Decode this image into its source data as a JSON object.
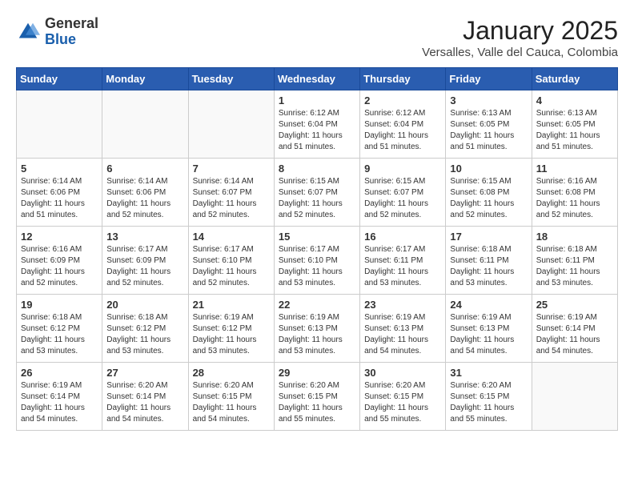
{
  "header": {
    "logo": {
      "general": "General",
      "blue": "Blue"
    },
    "title": "January 2025",
    "location": "Versalles, Valle del Cauca, Colombia"
  },
  "weekdays": [
    "Sunday",
    "Monday",
    "Tuesday",
    "Wednesday",
    "Thursday",
    "Friday",
    "Saturday"
  ],
  "weeks": [
    [
      {
        "day": "",
        "info": ""
      },
      {
        "day": "",
        "info": ""
      },
      {
        "day": "",
        "info": ""
      },
      {
        "day": "1",
        "info": "Sunrise: 6:12 AM\nSunset: 6:04 PM\nDaylight: 11 hours\nand 51 minutes."
      },
      {
        "day": "2",
        "info": "Sunrise: 6:12 AM\nSunset: 6:04 PM\nDaylight: 11 hours\nand 51 minutes."
      },
      {
        "day": "3",
        "info": "Sunrise: 6:13 AM\nSunset: 6:05 PM\nDaylight: 11 hours\nand 51 minutes."
      },
      {
        "day": "4",
        "info": "Sunrise: 6:13 AM\nSunset: 6:05 PM\nDaylight: 11 hours\nand 51 minutes."
      }
    ],
    [
      {
        "day": "5",
        "info": "Sunrise: 6:14 AM\nSunset: 6:06 PM\nDaylight: 11 hours\nand 51 minutes."
      },
      {
        "day": "6",
        "info": "Sunrise: 6:14 AM\nSunset: 6:06 PM\nDaylight: 11 hours\nand 52 minutes."
      },
      {
        "day": "7",
        "info": "Sunrise: 6:14 AM\nSunset: 6:07 PM\nDaylight: 11 hours\nand 52 minutes."
      },
      {
        "day": "8",
        "info": "Sunrise: 6:15 AM\nSunset: 6:07 PM\nDaylight: 11 hours\nand 52 minutes."
      },
      {
        "day": "9",
        "info": "Sunrise: 6:15 AM\nSunset: 6:07 PM\nDaylight: 11 hours\nand 52 minutes."
      },
      {
        "day": "10",
        "info": "Sunrise: 6:15 AM\nSunset: 6:08 PM\nDaylight: 11 hours\nand 52 minutes."
      },
      {
        "day": "11",
        "info": "Sunrise: 6:16 AM\nSunset: 6:08 PM\nDaylight: 11 hours\nand 52 minutes."
      }
    ],
    [
      {
        "day": "12",
        "info": "Sunrise: 6:16 AM\nSunset: 6:09 PM\nDaylight: 11 hours\nand 52 minutes."
      },
      {
        "day": "13",
        "info": "Sunrise: 6:17 AM\nSunset: 6:09 PM\nDaylight: 11 hours\nand 52 minutes."
      },
      {
        "day": "14",
        "info": "Sunrise: 6:17 AM\nSunset: 6:10 PM\nDaylight: 11 hours\nand 52 minutes."
      },
      {
        "day": "15",
        "info": "Sunrise: 6:17 AM\nSunset: 6:10 PM\nDaylight: 11 hours\nand 53 minutes."
      },
      {
        "day": "16",
        "info": "Sunrise: 6:17 AM\nSunset: 6:11 PM\nDaylight: 11 hours\nand 53 minutes."
      },
      {
        "day": "17",
        "info": "Sunrise: 6:18 AM\nSunset: 6:11 PM\nDaylight: 11 hours\nand 53 minutes."
      },
      {
        "day": "18",
        "info": "Sunrise: 6:18 AM\nSunset: 6:11 PM\nDaylight: 11 hours\nand 53 minutes."
      }
    ],
    [
      {
        "day": "19",
        "info": "Sunrise: 6:18 AM\nSunset: 6:12 PM\nDaylight: 11 hours\nand 53 minutes."
      },
      {
        "day": "20",
        "info": "Sunrise: 6:18 AM\nSunset: 6:12 PM\nDaylight: 11 hours\nand 53 minutes."
      },
      {
        "day": "21",
        "info": "Sunrise: 6:19 AM\nSunset: 6:12 PM\nDaylight: 11 hours\nand 53 minutes."
      },
      {
        "day": "22",
        "info": "Sunrise: 6:19 AM\nSunset: 6:13 PM\nDaylight: 11 hours\nand 53 minutes."
      },
      {
        "day": "23",
        "info": "Sunrise: 6:19 AM\nSunset: 6:13 PM\nDaylight: 11 hours\nand 54 minutes."
      },
      {
        "day": "24",
        "info": "Sunrise: 6:19 AM\nSunset: 6:13 PM\nDaylight: 11 hours\nand 54 minutes."
      },
      {
        "day": "25",
        "info": "Sunrise: 6:19 AM\nSunset: 6:14 PM\nDaylight: 11 hours\nand 54 minutes."
      }
    ],
    [
      {
        "day": "26",
        "info": "Sunrise: 6:19 AM\nSunset: 6:14 PM\nDaylight: 11 hours\nand 54 minutes."
      },
      {
        "day": "27",
        "info": "Sunrise: 6:20 AM\nSunset: 6:14 PM\nDaylight: 11 hours\nand 54 minutes."
      },
      {
        "day": "28",
        "info": "Sunrise: 6:20 AM\nSunset: 6:15 PM\nDaylight: 11 hours\nand 54 minutes."
      },
      {
        "day": "29",
        "info": "Sunrise: 6:20 AM\nSunset: 6:15 PM\nDaylight: 11 hours\nand 55 minutes."
      },
      {
        "day": "30",
        "info": "Sunrise: 6:20 AM\nSunset: 6:15 PM\nDaylight: 11 hours\nand 55 minutes."
      },
      {
        "day": "31",
        "info": "Sunrise: 6:20 AM\nSunset: 6:15 PM\nDaylight: 11 hours\nand 55 minutes."
      },
      {
        "day": "",
        "info": ""
      }
    ]
  ]
}
